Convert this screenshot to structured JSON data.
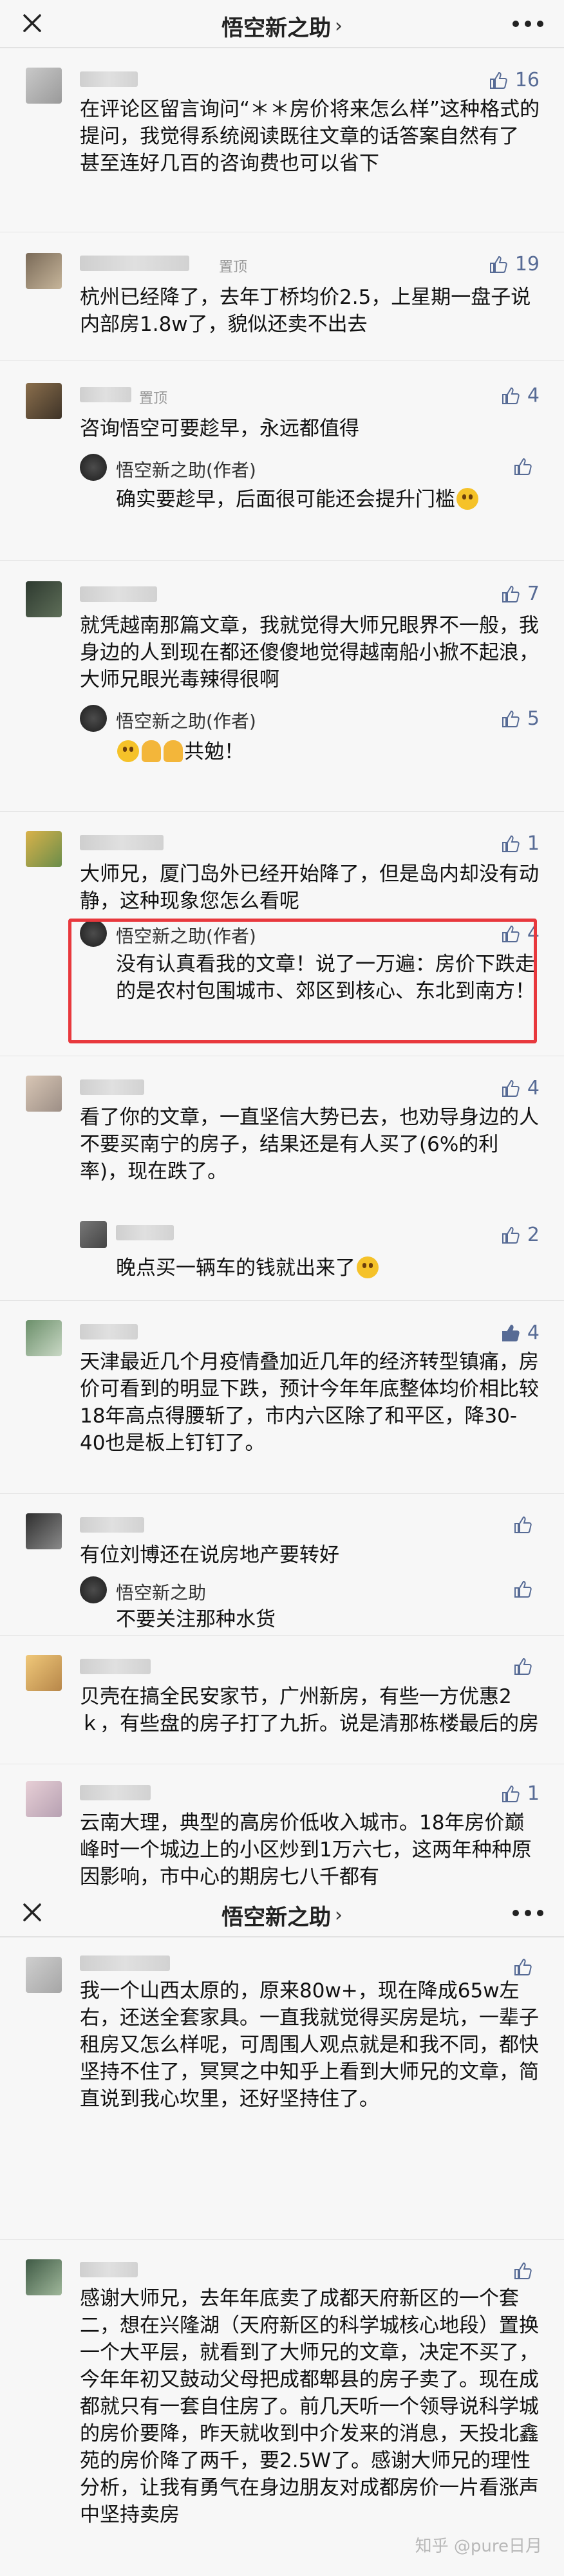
{
  "app": {
    "title": "悟空新之助",
    "title_chevron": "›"
  },
  "icons": {
    "close": "close-icon",
    "more": "more-icon",
    "like": "thumbs-up-icon"
  },
  "colors": {
    "like": "#576b95",
    "highlight": "#e8383d"
  },
  "comments": [
    {
      "pinned": "",
      "likes": "16",
      "text": "在评论区留言询问“＊＊房价将来怎么样”这种格式的提问，我觉得系统阅读既往文章的话答案自然有了 甚至连好几百的咨询费也可以省下"
    },
    {
      "pinned": "置顶",
      "likes": "19",
      "text": "杭州已经降了，去年丁桥均价2.5，上星期一盘子说内部房1.8w了，貌似还卖不出去"
    },
    {
      "pinned": "置顶",
      "likes": "4",
      "text": "咨询悟空可要趁早，永远都值得",
      "reply": {
        "name": "悟空新之助(作者)",
        "text": "确实要趁早，后面很可能还会提升门槛",
        "likes": ""
      }
    },
    {
      "pinned": "",
      "likes": "7",
      "text": "就凭越南那篇文章，我就觉得大师兄眼界不一般，我身边的人到现在都还傻傻地觉得越南船小掀不起浪，大师兄眼光毒辣得很啊",
      "reply": {
        "name": "悟空新之助(作者)",
        "text": "共勉！",
        "likes": "5"
      }
    },
    {
      "pinned": "",
      "likes": "1",
      "text": "大师兄，厦门岛外已经开始降了，但是岛内却没有动静，这种现象您怎么看呢",
      "reply": {
        "name": "悟空新之助(作者)",
        "text": "没有认真看我的文章！说了一万遍：房价下跌走的是农村包围城市、郊区到核心、东北到南方！",
        "likes": "4"
      }
    },
    {
      "pinned": "",
      "likes": "4",
      "text": "看了你的文章，一直坚信大势已去，也劝导身边的人不要买南宁的房子，结果还是有人买了(6%的利率)，现在跌了。",
      "reply": {
        "name": "",
        "text": "晚点买一辆车的钱就出来了",
        "likes": "2"
      }
    },
    {
      "pinned": "",
      "likes": "4",
      "text": "天津最近几个月疫情叠加近几年的经济转型镇痛，房价可看到的明显下跌，预计今年年底整体均价相比较18年高点得腰斩了，市内六区除了和平区，降30-40也是板上钉钉了。"
    },
    {
      "pinned": "",
      "likes": "",
      "text": "有位刘博还在说房地产要转好",
      "reply": {
        "name": "悟空新之助",
        "text": "不要关注那种水货",
        "likes": ""
      }
    },
    {
      "pinned": "",
      "likes": "",
      "text": "贝壳在搞全民安家节，广州新房，有些一方优惠2ｋ，有些盘的房子打了九折。说是清那栋楼最后的房"
    },
    {
      "pinned": "",
      "likes": "1",
      "text": "云南大理，典型的高房价低收入城市。18年房价巅峰时一个城边上的小区炒到1万六七，这两年种种原因影响，市中心的期房七八千都有"
    },
    {
      "pinned": "",
      "likes": "",
      "text": "我一个山西太原的，原来80w+，现在降成65w左右，还送全套家具。一直我就觉得买房是坑，一辈子租房又怎么样呢，可周围人观点就是和我不同，都快坚持不住了，冥冥之中知乎上看到大师兄的文章，简直说到我心坎里，还好坚持住了。"
    },
    {
      "pinned": "",
      "likes": "",
      "text": "感谢大师兄，去年年底卖了成都天府新区的一个套二，想在兴隆湖（天府新区的科学城核心地段）置换一个大平层，就看到了大师兄的文章，决定不买了，今年年初又鼓动父母把成都郫县的房子卖了。现在成都就只有一套自住房了。前几天听一个领导说科学城的房价要降，昨天就收到中介发来的消息，天投北鑫苑的房价降了两千，要2.5W了。感谢大师兄的理性分析，让我有勇气在身边朋友对成都房价一片看涨声中坚持卖房"
    }
  ],
  "watermark": "知乎 @pure日月"
}
